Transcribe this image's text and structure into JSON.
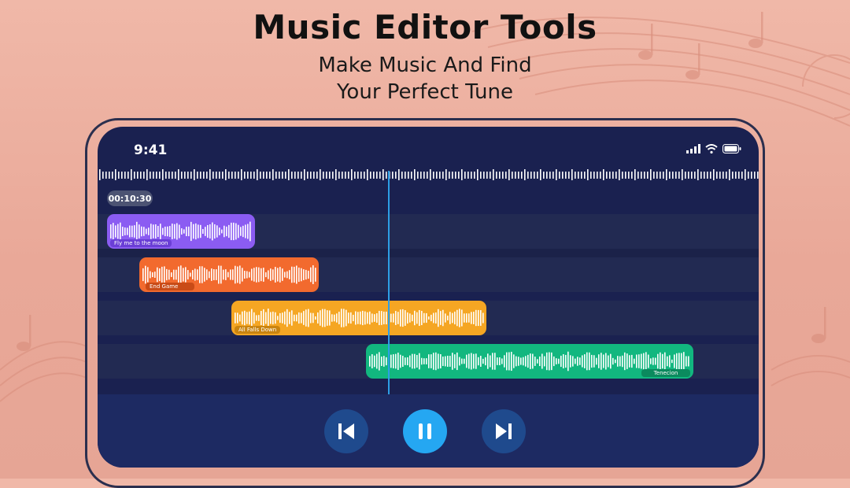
{
  "header": {
    "title": "Music Editor Tools",
    "subtitle_line1": "Make Music And Find",
    "subtitle_line2": "Your Perfect Tune"
  },
  "status_bar": {
    "time": "9:41",
    "icons": [
      "cellular-signal-icon",
      "wifi-icon",
      "battery-icon"
    ]
  },
  "timeline": {
    "current_time": "00:10:30"
  },
  "tracks": [
    {
      "name": "Fly me to the moon",
      "color": "#8b5cf2",
      "label_color": "#6b3fd6"
    },
    {
      "name": "End Game",
      "color": "#f26a2e",
      "label_color": "#c94b17"
    },
    {
      "name": "All Falls Down",
      "color": "#f5a623",
      "label_color": "#c98410"
    },
    {
      "name": "Tenecion",
      "color": "#12b77f",
      "label_color": "#0b8a5e"
    }
  ],
  "controls": {
    "previous": "skip-previous-icon",
    "play_pause": "pause-icon",
    "next": "skip-next-icon"
  },
  "colors": {
    "background": "#eaa999",
    "phone_screen": "#1a2150",
    "playhead": "#2d9fe6",
    "accent": "#25a7f2"
  }
}
